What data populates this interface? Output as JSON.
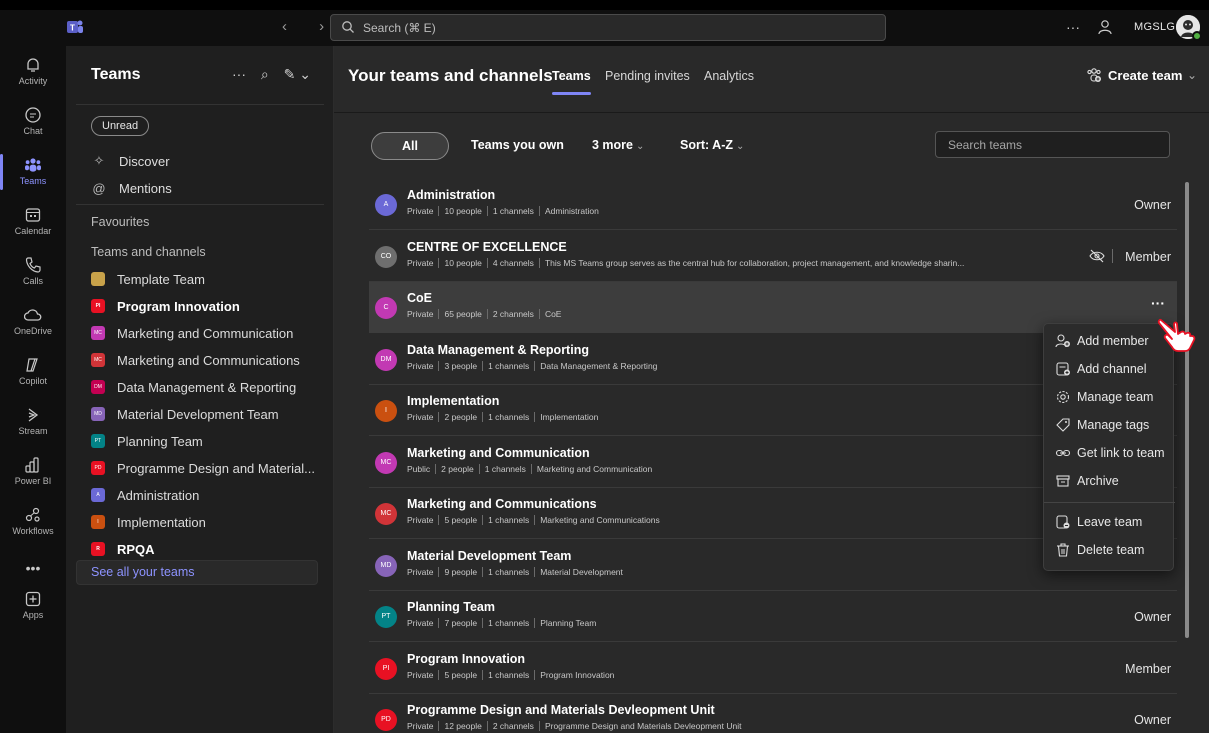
{
  "titlebar": {
    "search_placeholder": "Search (⌘ E)",
    "more": "···",
    "org_name": "MGSLG",
    "nav_arrows": "‹ ›"
  },
  "rail": {
    "items": [
      {
        "label": "Activity"
      },
      {
        "label": "Chat"
      },
      {
        "label": "Teams"
      },
      {
        "label": "Calendar"
      },
      {
        "label": "Calls"
      },
      {
        "label": "OneDrive"
      },
      {
        "label": "Copilot"
      },
      {
        "label": "Stream"
      },
      {
        "label": "Power BI"
      },
      {
        "label": "Workflows"
      },
      {
        "label": "Apps"
      }
    ],
    "more": "•••"
  },
  "leftpane": {
    "title": "Teams",
    "icons": {
      "more": "···",
      "search": "⌕",
      "compose": "✎ ⌄"
    },
    "unread_chip": "Unread",
    "discover": "Discover",
    "mentions": "Mentions",
    "favourites": "Favourites",
    "teams_and_channels": "Teams and channels",
    "teams": [
      {
        "name": "Template Team",
        "color": "#c8a24a",
        "initials": "",
        "bold": false
      },
      {
        "name": "Program Innovation",
        "color": "#e81123",
        "initials": "PI",
        "bold": true
      },
      {
        "name": "Marketing and Communication",
        "color": "#c239b3",
        "initials": "MC",
        "bold": false
      },
      {
        "name": "Marketing and Communications",
        "color": "#d13438",
        "initials": "MC",
        "bold": false
      },
      {
        "name": "Data Management & Reporting",
        "color": "#c30052",
        "initials": "DM",
        "bold": false
      },
      {
        "name": "Material Development Team",
        "color": "#8764b8",
        "initials": "MD",
        "bold": false
      },
      {
        "name": "Planning Team",
        "color": "#038387",
        "initials": "PT",
        "bold": false
      },
      {
        "name": "Programme Design and Material...",
        "color": "#e81123",
        "initials": "PD",
        "bold": false
      },
      {
        "name": "Administration",
        "color": "#6b69d6",
        "initials": "A",
        "bold": false
      },
      {
        "name": "Implementation",
        "color": "#ca5010",
        "initials": "I",
        "bold": false
      },
      {
        "name": "RPQA",
        "color": "#e81123",
        "initials": "R",
        "bold": true
      }
    ],
    "see_all": "See all your teams"
  },
  "main": {
    "title": "Your teams and channels",
    "tabs": [
      {
        "label": "Teams",
        "active": true
      },
      {
        "label": "Pending invites",
        "active": false
      },
      {
        "label": "Analytics",
        "active": false
      }
    ],
    "create_team": "Create team",
    "create_chevron": "⌄",
    "filters": {
      "all": "All",
      "teams_you_own": "Teams you own",
      "more": "3 more",
      "sort": "Sort: A-Z",
      "chevron": "⌄"
    },
    "search_placeholder": "Search teams",
    "rows": [
      {
        "name": "Administration",
        "initials": "A",
        "color": "#6b69d6",
        "privacy": "Private",
        "people": "10 people",
        "channels": "1 channels",
        "desc": "Administration",
        "role": "Owner"
      },
      {
        "name": "CENTRE OF EXCELLENCE",
        "initials": "CO",
        "color": "#6e6e6e",
        "privacy": "Private",
        "people": "10 people",
        "channels": "4 channels",
        "desc": "This MS Teams group serves as the central hub for collaboration, project management, and knowledge sharin...",
        "role": "Member"
      },
      {
        "name": "CoE",
        "initials": "C",
        "color": "#c239b3",
        "privacy": "Private",
        "people": "65 people",
        "channels": "2 channels",
        "desc": "CoE",
        "role": ""
      },
      {
        "name": "Data Management & Reporting",
        "initials": "DM",
        "color": "#c239b3",
        "privacy": "Private",
        "people": "3 people",
        "channels": "1 channels",
        "desc": "Data Management & Reporting",
        "role": ""
      },
      {
        "name": "Implementation",
        "initials": "I",
        "color": "#ca5010",
        "privacy": "Private",
        "people": "2 people",
        "channels": "1 channels",
        "desc": "Implementation",
        "role": ""
      },
      {
        "name": "Marketing and Communication",
        "initials": "MC",
        "color": "#c239b3",
        "privacy": "Public",
        "people": "2 people",
        "channels": "1 channels",
        "desc": "Marketing and Communication",
        "role": ""
      },
      {
        "name": "Marketing and Communications",
        "initials": "MC",
        "color": "#d13438",
        "privacy": "Private",
        "people": "5 people",
        "channels": "1 channels",
        "desc": "Marketing and Communications",
        "role": ""
      },
      {
        "name": "Material Development Team",
        "initials": "MD",
        "color": "#8764b8",
        "privacy": "Private",
        "people": "9 people",
        "channels": "1 channels",
        "desc": "Material Development",
        "role": ""
      },
      {
        "name": "Planning Team",
        "initials": "PT",
        "color": "#038387",
        "privacy": "Private",
        "people": "7 people",
        "channels": "1 channels",
        "desc": "Planning Team",
        "role": "Owner"
      },
      {
        "name": "Program Innovation",
        "initials": "PI",
        "color": "#e81123",
        "privacy": "Private",
        "people": "5 people",
        "channels": "1 channels",
        "desc": "Program Innovation",
        "role": "Member"
      },
      {
        "name": "Programme Design and Materials Devleopment Unit",
        "initials": "PD",
        "color": "#e81123",
        "privacy": "Private",
        "people": "12 people",
        "channels": "2 channels",
        "desc": "Programme Design and Materials Devleopment Unit",
        "role": "Owner"
      }
    ],
    "row_more": "···"
  },
  "context_menu": {
    "items": [
      {
        "label": "Add member",
        "icon": "person-add-icon"
      },
      {
        "label": "Add channel",
        "icon": "channel-add-icon"
      },
      {
        "label": "Manage team",
        "icon": "gear-icon"
      },
      {
        "label": "Manage tags",
        "icon": "tag-icon"
      },
      {
        "label": "Get link to team",
        "icon": "link-icon"
      },
      {
        "label": "Archive",
        "icon": "archive-icon"
      },
      {
        "label": "Leave team",
        "icon": "leave-icon"
      },
      {
        "label": "Delete team",
        "icon": "trash-icon"
      }
    ]
  },
  "colors": {
    "accent": "#7f85f5",
    "background": "#1f1f1f",
    "main_background": "#292929"
  }
}
